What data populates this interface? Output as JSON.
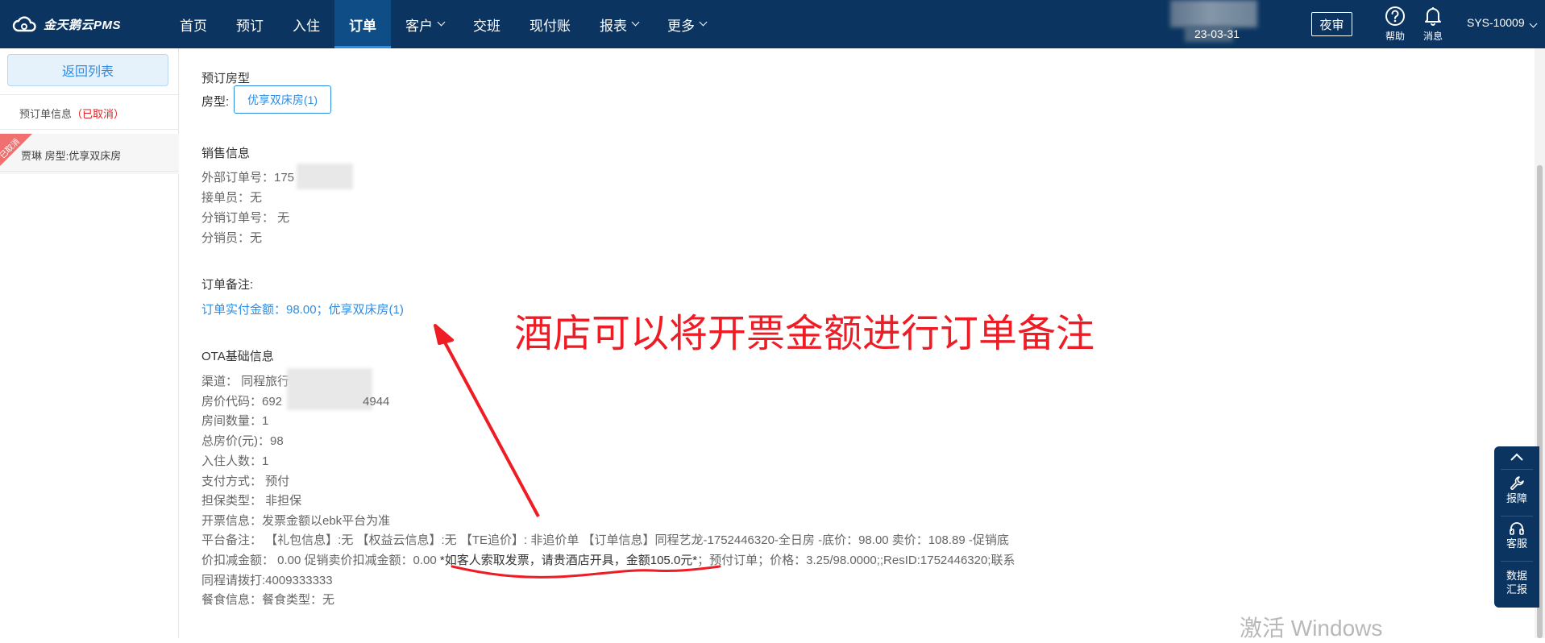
{
  "header": {
    "logo_text": "金天鹅云PMS",
    "nav": [
      {
        "label": "首页",
        "active": false,
        "dropdown": false
      },
      {
        "label": "预订",
        "active": false,
        "dropdown": false
      },
      {
        "label": "入住",
        "active": false,
        "dropdown": false
      },
      {
        "label": "订单",
        "active": true,
        "dropdown": false
      },
      {
        "label": "客户",
        "active": false,
        "dropdown": true
      },
      {
        "label": "交班",
        "active": false,
        "dropdown": false
      },
      {
        "label": "现付账",
        "active": false,
        "dropdown": false
      },
      {
        "label": "报表",
        "active": false,
        "dropdown": true
      },
      {
        "label": "更多",
        "active": false,
        "dropdown": true
      }
    ],
    "date": "23-03-31",
    "night_audit": "夜审",
    "help_label": "帮助",
    "message_label": "消息",
    "user": "SYS-10009"
  },
  "sidebar": {
    "back_label": "返回列表",
    "order_info_label": "预订单信息",
    "order_status": "（已取消）",
    "ribbon_label": "已取消",
    "room_item_label": "贾琳  房型:优享双床房"
  },
  "booking_room": {
    "title": "预订房型",
    "room_type_label": "房型:",
    "room_tag": "优享双床房(1)"
  },
  "sales_info": {
    "title": "销售信息",
    "external_order": "外部订单号：175",
    "receiver": "接单员：无",
    "distribution_order": "分销订单号： 无",
    "distributor": "分销员：无"
  },
  "order_remark": {
    "title": "订单备注:",
    "content": "订单实付金额：98.00；优享双床房(1)"
  },
  "ota": {
    "title": "OTA基础信息",
    "channel": "渠道： 同程旅行",
    "rate_code_prefix": "房价代码：692",
    "rate_code_suffix": "4944",
    "room_count": "房间数量：1",
    "total_price": "总房价(元)：98",
    "guests": "入住人数：1",
    "payment": "支付方式： 预付",
    "guarantee": "担保类型： 非担保",
    "invoice": "开票信息：发票金额以ebk平台为准",
    "platform_remark_line1": "平台备注： 【礼包信息】:无 【权益云信息】:无 【TE追价】: 非追价单 【订单信息】同程艺龙-1752446320-全日房 -底价：98.00 卖价：108.89 -促销底",
    "platform_remark_line2_a": "价扣减金额： 0.00 促销卖价扣减金额：0.00 ",
    "platform_remark_line2_highlight": "*如客人索取发票，请贵酒店开具，金额105.0元*",
    "platform_remark_line2_b": "；预付订单；价格：3.25/98.0000;;ResID:1752446320;联系",
    "platform_remark_line3": "同程请拨打:4009333333",
    "meal": "餐食信息：餐食类型：无"
  },
  "annotation": {
    "text": "酒店可以将开票金额进行订单备注",
    "color": "#ee1c25"
  },
  "float_panel": {
    "report_label": "报障",
    "service_label": "客服",
    "data_label_1": "数据",
    "data_label_2": "汇报"
  },
  "watermark": "激活 Windows",
  "colors": {
    "nav_bg": "#0b3560",
    "accent": "#2f8de4",
    "annotation_red": "#ee1c25",
    "cancel_red": "#e02020"
  }
}
